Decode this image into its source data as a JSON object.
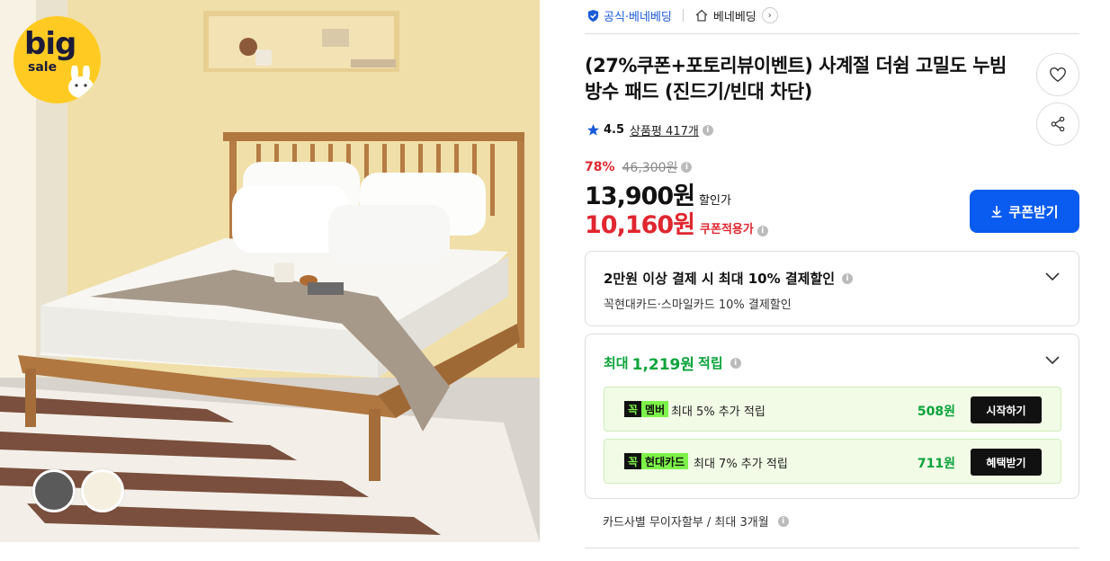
{
  "image": {
    "badge_big": "big",
    "badge_sale": "sale",
    "swatches": [
      "#5a5a5a",
      "#f4efdf"
    ]
  },
  "store": {
    "official_label": "공식·베네베딩",
    "shop_name": "베네베딩",
    "arrow": "›"
  },
  "product": {
    "title": "(27%쿠폰+포토리뷰이벤트) 사계절 더쉼 고밀도 누빔 방수 패드 (진드기/빈대 차단)"
  },
  "rating": {
    "score": "4.5",
    "reviews_label": "상품평 417개"
  },
  "price": {
    "discount_rate": "78%",
    "original": "46,300원",
    "sale_price": "13,900원",
    "sale_label": "할인가",
    "coupon_price": "10,160원",
    "coupon_label": "쿠폰적용가",
    "coupon_button": "쿠폰받기"
  },
  "payment": {
    "headline": "2만원 이상 결제 시 최대 10% 결제할인",
    "sub": "꼭현대카드·스마일카드 10% 결제할인"
  },
  "points": {
    "prefix": "최대",
    "amount": "1,219원",
    "suffix": "적립",
    "rewards": [
      {
        "tag_k": "꼭",
        "tag_name": "멤버",
        "text": "최대 5% 추가 적립",
        "points": "508원",
        "button": "시작하기"
      },
      {
        "tag_k": "꼭",
        "tag_name": "현대카드",
        "text": "최대 7% 추가 적립",
        "points": "711원",
        "button": "혜택받기"
      }
    ]
  },
  "installment": "카드사별 무이자할부 / 최대 3개월",
  "colors": {
    "accent_blue": "#0a5bf0",
    "sale_red": "#e0262f",
    "point_green": "#0aa33b"
  }
}
